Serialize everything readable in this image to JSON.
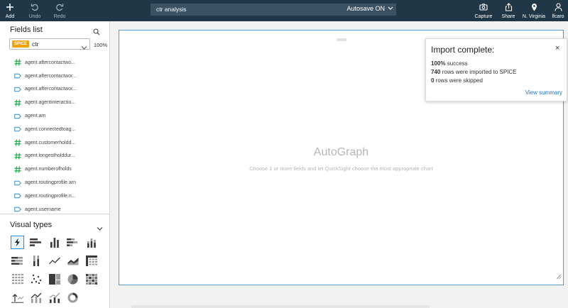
{
  "toolbar": {
    "add": "Add",
    "undo": "Undo",
    "redo": "Redo",
    "capture": "Capture",
    "share": "Share",
    "region": "N. Virginia",
    "user": "lfcaro"
  },
  "analysis": {
    "name": "ctr analysis",
    "autosave": "Autosave ON"
  },
  "fields_panel": {
    "title": "Fields list",
    "dataset_badge": "SPICE",
    "dataset_name": "ctr",
    "usage": "100%",
    "fields": [
      {
        "name": "agent.aftercontactwo...",
        "type": "measure"
      },
      {
        "name": "agent.aftercontactwor...",
        "type": "dimension"
      },
      {
        "name": "agent.aftercontactwor...",
        "type": "dimension"
      },
      {
        "name": "agent.agentinteractio...",
        "type": "measure"
      },
      {
        "name": "agent.arn",
        "type": "dimension"
      },
      {
        "name": "agent.connectedtoag...",
        "type": "dimension"
      },
      {
        "name": "agent.customerholdd...",
        "type": "measure"
      },
      {
        "name": "agent.longestholddur...",
        "type": "measure"
      },
      {
        "name": "agent.numberofholds",
        "type": "measure"
      },
      {
        "name": "agent.routingprofile.arn",
        "type": "dimension"
      },
      {
        "name": "agent.routingprofile.n...",
        "type": "dimension"
      },
      {
        "name": "agent.username",
        "type": "dimension"
      }
    ]
  },
  "visual_types": {
    "title": "Visual types",
    "items": [
      "autograph-icon",
      "horizontal-bar-icon",
      "vertical-bar-icon",
      "horizontal-stacked-bar-icon",
      "vertical-stacked-bar-icon",
      "horizontal-100-bar-icon",
      "vertical-100-bar-icon",
      "line-chart-icon",
      "area-chart-icon",
      "pivot-table-icon",
      "table-icon",
      "scatter-plot-icon",
      "tree-map-icon",
      "pie-chart-icon",
      "heat-map-icon",
      "kpi-icon",
      "combo-chart-icon",
      "combo-line-chart-icon",
      "donut-chart-icon"
    ]
  },
  "visual": {
    "title": "AutoGraph",
    "subtitle": "Choose 1 or more fields and let QuickSight choose the most appropriate chart"
  },
  "notification": {
    "title": "Import complete:",
    "close": "×",
    "success_value": "100%",
    "success_text": " success",
    "imported_value": "740",
    "imported_text": " rows were imported to SPICE",
    "skipped_value": "0",
    "skipped_text": " rows were skipped",
    "link": "View summary"
  },
  "colors": {
    "topbar": "#1f3747",
    "measure": "#2fae57",
    "dimension": "#2a8fd0",
    "spice": "#f0a30a",
    "link": "#1a73c7"
  }
}
